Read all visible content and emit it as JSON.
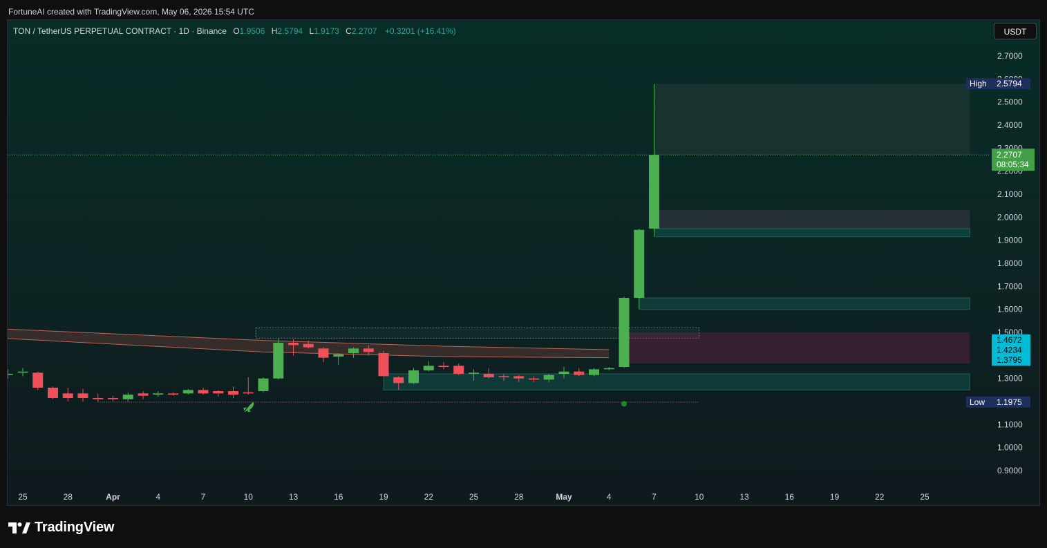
{
  "caption": "FortuneAI created with TradingView.com, May 06, 2026 15:54 UTC",
  "legend": {
    "symbol": "TON / TetherUS PERPETUAL CONTRACT · 1D · Binance",
    "o_label": "O",
    "o_value": "1.9506",
    "h_label": "H",
    "h_value": "2.5794",
    "l_label": "L",
    "l_value": "1.9173",
    "c_label": "C",
    "c_value": "2.2707",
    "change": "+0.3201 (+16.41%)"
  },
  "currency_button": "USDT",
  "brand": "TradingView",
  "colors": {
    "up": "#4caf50",
    "down": "#f0505a",
    "axis_text": "#d1d4dc",
    "label_blue": "#1e2f5e",
    "label_cyan": "#00bcd4",
    "label_green": "#43a047"
  },
  "chart_data": {
    "type": "candlestick",
    "ylim": [
      0.85,
      2.79
    ],
    "y_ticks": [
      "2.7000",
      "2.6000",
      "2.5000",
      "2.4000",
      "2.3000",
      "2.2000",
      "2.1000",
      "2.0000",
      "1.9000",
      "1.8000",
      "1.7000",
      "1.6000",
      "1.5000",
      "1.4000",
      "1.3000",
      "1.2000",
      "1.1000",
      "1.0000",
      "0.9000"
    ],
    "x_ticks": [
      {
        "label": "25",
        "day": -8
      },
      {
        "label": "28",
        "day": -5
      },
      {
        "label": "Apr",
        "day": -2
      },
      {
        "label": "4",
        "day": 1
      },
      {
        "label": "7",
        "day": 4
      },
      {
        "label": "10",
        "day": 7
      },
      {
        "label": "13",
        "day": 10
      },
      {
        "label": "16",
        "day": 13
      },
      {
        "label": "19",
        "day": 16
      },
      {
        "label": "22",
        "day": 19
      },
      {
        "label": "25",
        "day": 22
      },
      {
        "label": "28",
        "day": 25
      },
      {
        "label": "May",
        "day": 28
      },
      {
        "label": "4",
        "day": 31
      },
      {
        "label": "7",
        "day": 34
      },
      {
        "label": "10",
        "day": 37
      },
      {
        "label": "13",
        "day": 40
      },
      {
        "label": "16",
        "day": 43
      },
      {
        "label": "19",
        "day": 46
      },
      {
        "label": "22",
        "day": 49
      },
      {
        "label": "25",
        "day": 52
      }
    ],
    "candles": [
      {
        "day": -10,
        "o": 1.3,
        "h": 1.32,
        "l": 1.25,
        "c": 1.27
      },
      {
        "day": -9,
        "o": 1.315,
        "h": 1.34,
        "l": 1.3,
        "c": 1.32
      },
      {
        "day": -8,
        "o": 1.325,
        "h": 1.345,
        "l": 1.31,
        "c": 1.33
      },
      {
        "day": -7,
        "o": 1.325,
        "h": 1.33,
        "l": 1.25,
        "c": 1.26
      },
      {
        "day": -6,
        "o": 1.26,
        "h": 1.265,
        "l": 1.21,
        "c": 1.215
      },
      {
        "day": -5,
        "o": 1.235,
        "h": 1.26,
        "l": 1.2,
        "c": 1.215
      },
      {
        "day": -4,
        "o": 1.235,
        "h": 1.255,
        "l": 1.2,
        "c": 1.215
      },
      {
        "day": -3,
        "o": 1.215,
        "h": 1.235,
        "l": 1.2,
        "c": 1.21
      },
      {
        "day": -2,
        "o": 1.215,
        "h": 1.225,
        "l": 1.2,
        "c": 1.21
      },
      {
        "day": -1,
        "o": 1.21,
        "h": 1.24,
        "l": 1.2,
        "c": 1.23
      },
      {
        "day": 0,
        "o": 1.235,
        "h": 1.245,
        "l": 1.21,
        "c": 1.225
      },
      {
        "day": 1,
        "o": 1.23,
        "h": 1.245,
        "l": 1.22,
        "c": 1.235
      },
      {
        "day": 2,
        "o": 1.235,
        "h": 1.24,
        "l": 1.225,
        "c": 1.23
      },
      {
        "day": 3,
        "o": 1.235,
        "h": 1.255,
        "l": 1.23,
        "c": 1.25
      },
      {
        "day": 4,
        "o": 1.25,
        "h": 1.26,
        "l": 1.23,
        "c": 1.235
      },
      {
        "day": 5,
        "o": 1.245,
        "h": 1.25,
        "l": 1.22,
        "c": 1.235
      },
      {
        "day": 6,
        "o": 1.245,
        "h": 1.265,
        "l": 1.215,
        "c": 1.23
      },
      {
        "day": 7,
        "o": 1.24,
        "h": 1.305,
        "l": 1.23,
        "c": 1.235
      },
      {
        "day": 8,
        "o": 1.245,
        "h": 1.305,
        "l": 1.24,
        "c": 1.3
      },
      {
        "day": 9,
        "o": 1.3,
        "h": 1.475,
        "l": 1.295,
        "c": 1.455
      },
      {
        "day": 10,
        "o": 1.455,
        "h": 1.47,
        "l": 1.4,
        "c": 1.445
      },
      {
        "day": 11,
        "o": 1.45,
        "h": 1.465,
        "l": 1.43,
        "c": 1.435
      },
      {
        "day": 12,
        "o": 1.43,
        "h": 1.435,
        "l": 1.37,
        "c": 1.39
      },
      {
        "day": 13,
        "o": 1.395,
        "h": 1.41,
        "l": 1.36,
        "c": 1.405
      },
      {
        "day": 14,
        "o": 1.41,
        "h": 1.435,
        "l": 1.39,
        "c": 1.43
      },
      {
        "day": 15,
        "o": 1.43,
        "h": 1.445,
        "l": 1.4,
        "c": 1.415
      },
      {
        "day": 16,
        "o": 1.41,
        "h": 1.42,
        "l": 1.31,
        "c": 1.31
      },
      {
        "day": 17,
        "o": 1.305,
        "h": 1.31,
        "l": 1.25,
        "c": 1.28
      },
      {
        "day": 18,
        "o": 1.28,
        "h": 1.345,
        "l": 1.275,
        "c": 1.335
      },
      {
        "day": 19,
        "o": 1.335,
        "h": 1.375,
        "l": 1.33,
        "c": 1.355
      },
      {
        "day": 20,
        "o": 1.355,
        "h": 1.37,
        "l": 1.34,
        "c": 1.35
      },
      {
        "day": 21,
        "o": 1.355,
        "h": 1.365,
        "l": 1.315,
        "c": 1.32
      },
      {
        "day": 22,
        "o": 1.32,
        "h": 1.34,
        "l": 1.29,
        "c": 1.325
      },
      {
        "day": 23,
        "o": 1.32,
        "h": 1.345,
        "l": 1.3,
        "c": 1.305
      },
      {
        "day": 24,
        "o": 1.31,
        "h": 1.32,
        "l": 1.29,
        "c": 1.305
      },
      {
        "day": 25,
        "o": 1.31,
        "h": 1.315,
        "l": 1.285,
        "c": 1.3
      },
      {
        "day": 26,
        "o": 1.3,
        "h": 1.31,
        "l": 1.285,
        "c": 1.295
      },
      {
        "day": 27,
        "o": 1.295,
        "h": 1.32,
        "l": 1.285,
        "c": 1.315
      },
      {
        "day": 28,
        "o": 1.32,
        "h": 1.35,
        "l": 1.3,
        "c": 1.33
      },
      {
        "day": 29,
        "o": 1.33,
        "h": 1.345,
        "l": 1.31,
        "c": 1.315
      },
      {
        "day": 30,
        "o": 1.315,
        "h": 1.345,
        "l": 1.31,
        "c": 1.34
      },
      {
        "day": 31,
        "o": 1.34,
        "h": 1.35,
        "l": 1.335,
        "c": 1.345
      },
      {
        "day": 32,
        "o": 1.35,
        "h": 1.655,
        "l": 1.345,
        "c": 1.65
      },
      {
        "day": 33,
        "o": 1.65,
        "h": 1.95,
        "l": 1.6,
        "c": 1.945
      },
      {
        "day": 34,
        "o": 1.9506,
        "h": 2.5794,
        "l": 1.9173,
        "c": 2.2707
      }
    ],
    "price_labels": [
      {
        "name": "high",
        "tag": "High",
        "value": "2.5794",
        "price": 2.5794,
        "style": "blue"
      },
      {
        "name": "last",
        "value": "2.2707",
        "sub": "08:05:34",
        "price": 2.2707,
        "style": "green"
      },
      {
        "name": "band-top",
        "value": "1.4672",
        "price": 1.4672,
        "style": "cyan"
      },
      {
        "name": "band-mid",
        "value": "1.4234",
        "price": 1.4234,
        "style": "cyan"
      },
      {
        "name": "band-low",
        "value": "1.3795",
        "price": 1.3795,
        "style": "cyan"
      },
      {
        "name": "low",
        "tag": "Low",
        "value": "1.1975",
        "price": 1.1975,
        "style": "blue"
      }
    ],
    "ma_band": [
      {
        "day": -11,
        "top": 1.52,
        "bot": 1.48
      },
      {
        "day": 8,
        "top": 1.465,
        "bot": 1.415
      },
      {
        "day": 20,
        "top": 1.44,
        "bot": 1.395
      },
      {
        "day": 31,
        "top": 1.425,
        "bot": 1.39
      }
    ],
    "zones": [
      {
        "from_day": 7.5,
        "to_day": 37,
        "top": 1.52,
        "bot": 1.475,
        "kind": "outline"
      },
      {
        "from_day": 34,
        "to_day": 55,
        "top": 2.5794,
        "bot": 2.2707,
        "kind": "range"
      },
      {
        "from_day": 34,
        "to_day": 55,
        "top": 2.03,
        "bot": 1.95,
        "kind": "fill"
      },
      {
        "from_day": 34,
        "to_day": 55,
        "top": 1.95,
        "bot": 1.915,
        "kind": "teal"
      },
      {
        "from_day": 33,
        "to_day": 55,
        "top": 1.65,
        "bot": 1.6,
        "kind": "teal"
      },
      {
        "from_day": 32,
        "to_day": 55,
        "top": 1.5,
        "bot": 1.365,
        "kind": "pink"
      },
      {
        "from_day": 16,
        "to_day": 55,
        "top": 1.32,
        "bot": 1.25,
        "kind": "teal"
      }
    ],
    "low_line": {
      "from_day": -3,
      "to_day": 37,
      "price": 1.1975
    },
    "marker_dot": {
      "day": 32,
      "price": 1.19
    },
    "rocket_marker": {
      "day": 7,
      "price": 1.19
    }
  }
}
